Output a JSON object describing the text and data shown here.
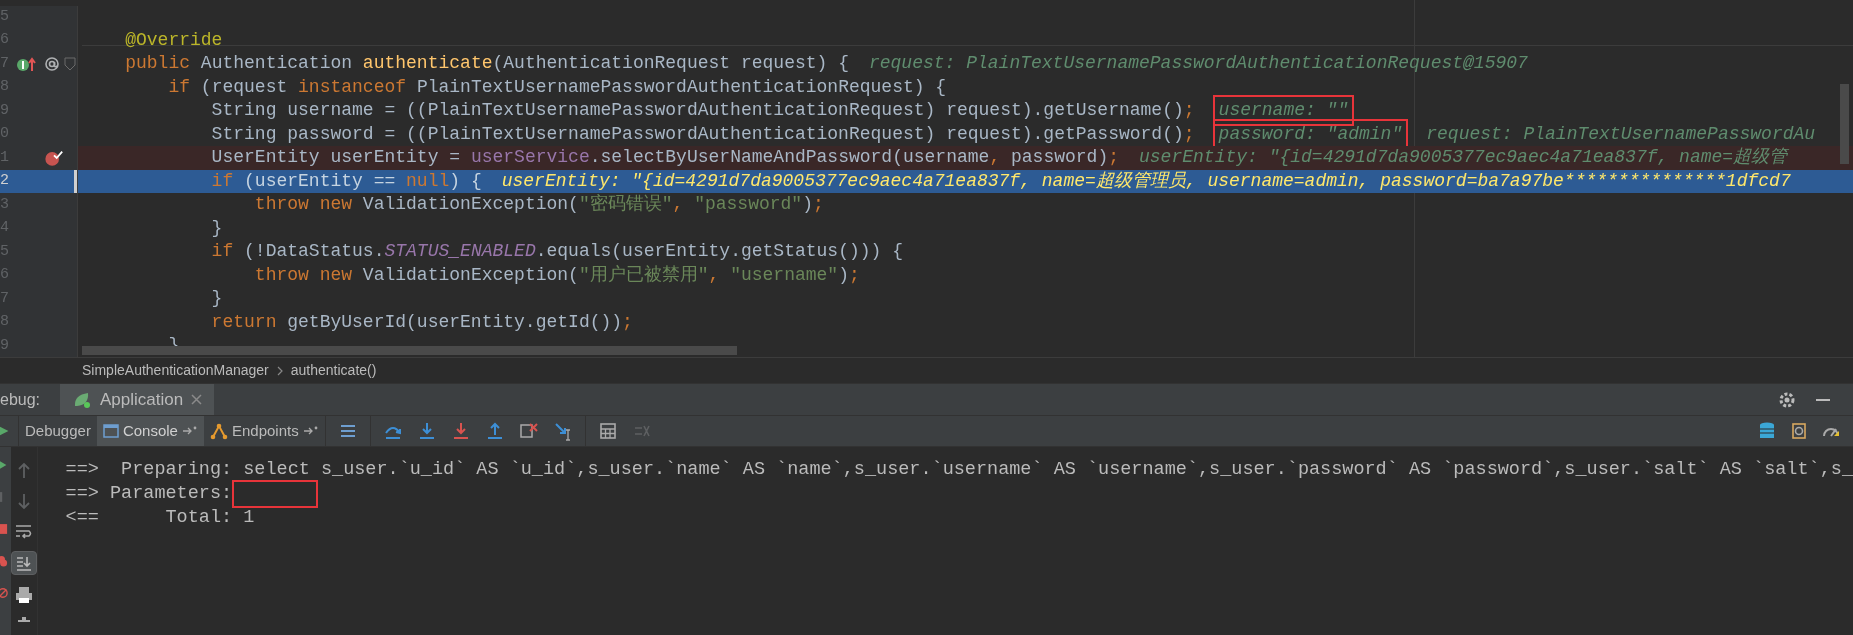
{
  "editor": {
    "lines": [
      {
        "number": "5",
        "implements": false,
        "foldable": false,
        "breakpoint": false,
        "current": false
      },
      {
        "number": "6",
        "implements": false,
        "foldable": false,
        "breakpoint": false,
        "current": false,
        "tokens": [
          {
            "kind": "annotation",
            "text": "    @Override"
          }
        ]
      },
      {
        "number": "7",
        "implements": true,
        "foldable": true,
        "breakpoint": false,
        "current": false,
        "tokens": [
          {
            "kind": "keyword",
            "text": "    public "
          },
          {
            "kind": "plain",
            "text": "Authentication "
          },
          {
            "kind": "method",
            "text": "authenticate"
          },
          {
            "kind": "plain",
            "text": "(AuthenticationRequest request) {"
          },
          {
            "kind": "inline",
            "text": "request: PlainTextUsernamePasswordAuthenticationRequest@15907"
          }
        ]
      },
      {
        "number": "8",
        "implements": false,
        "foldable": false,
        "breakpoint": false,
        "current": false,
        "tokens": [
          {
            "kind": "keyword",
            "text": "        if "
          },
          {
            "kind": "plain",
            "text": "(request "
          },
          {
            "kind": "keyword",
            "text": "instanceof "
          },
          {
            "kind": "plain",
            "text": "PlainTextUsernamePasswordAuthenticationRequest) {"
          }
        ]
      },
      {
        "number": "9",
        "implements": false,
        "foldable": false,
        "breakpoint": false,
        "current": false,
        "tokens": [
          {
            "kind": "plain",
            "text": "            String username = ((PlainTextUsernamePasswordAuthenticationRequest) request).getUsername()"
          },
          {
            "kind": "keyword",
            "text": ";"
          },
          {
            "kind": "inline",
            "text": "username: \"\"",
            "boxed": true
          }
        ]
      },
      {
        "number": "0",
        "implements": false,
        "foldable": false,
        "breakpoint": false,
        "current": false,
        "tokens": [
          {
            "kind": "plain",
            "text": "            String password = ((PlainTextUsernamePasswordAuthenticationRequest) request).getPassword()"
          },
          {
            "kind": "keyword",
            "text": ";"
          },
          {
            "kind": "inline",
            "text": "password: \"admin\"",
            "boxed": true
          },
          {
            "kind": "inline",
            "text": "request: PlainTextUsernamePasswordAu",
            "boxed": false
          }
        ]
      },
      {
        "number": "1",
        "implements": false,
        "foldable": false,
        "breakpoint": true,
        "current": false,
        "tokens": [
          {
            "kind": "plain",
            "text": "            UserEntity userEntity = "
          },
          {
            "kind": "field",
            "text": "userService"
          },
          {
            "kind": "plain",
            "text": ".selectByUserNameAndPassword(username"
          },
          {
            "kind": "keyword",
            "text": ", "
          },
          {
            "kind": "plain",
            "text": "password)"
          },
          {
            "kind": "keyword",
            "text": ";"
          },
          {
            "kind": "inline",
            "text": "userEntity: \"{id=4291d7da9005377ec9aec4a71ea837f, name=超级管"
          }
        ]
      },
      {
        "number": "2",
        "implements": false,
        "foldable": false,
        "breakpoint": false,
        "current": true,
        "tokens": [
          {
            "kind": "keyword",
            "text": "            if "
          },
          {
            "kind": "plain",
            "text": "(userEntity == "
          },
          {
            "kind": "keyword",
            "text": "null"
          },
          {
            "kind": "plain",
            "text": ") {"
          },
          {
            "kind": "inline",
            "text": "userEntity: \"{id=4291d7da9005377ec9aec4a71ea837f, name=超级管理员, username=admin, password=ba7a97be***************1dfcd7"
          }
        ]
      },
      {
        "number": "3",
        "implements": false,
        "foldable": false,
        "breakpoint": false,
        "current": false,
        "tokens": [
          {
            "kind": "keyword",
            "text": "                throw new "
          },
          {
            "kind": "plain",
            "text": "ValidationException("
          },
          {
            "kind": "string",
            "text": "\"密码错误\""
          },
          {
            "kind": "keyword",
            "text": ", "
          },
          {
            "kind": "string",
            "text": "\"password\""
          },
          {
            "kind": "plain",
            "text": ")"
          },
          {
            "kind": "keyword",
            "text": ";"
          }
        ]
      },
      {
        "number": "4",
        "implements": false,
        "foldable": false,
        "breakpoint": false,
        "current": false,
        "tokens": [
          {
            "kind": "plain",
            "text": "            }"
          }
        ]
      },
      {
        "number": "5",
        "implements": false,
        "foldable": false,
        "breakpoint": false,
        "current": false,
        "tokens": [
          {
            "kind": "keyword",
            "text": "            if "
          },
          {
            "kind": "plain",
            "text": "(!DataStatus."
          },
          {
            "kind": "static",
            "text": "STATUS_ENABLED"
          },
          {
            "kind": "plain",
            "text": ".equals(userEntity.getStatus())) {"
          }
        ]
      },
      {
        "number": "6",
        "implements": false,
        "foldable": false,
        "breakpoint": false,
        "current": false,
        "tokens": [
          {
            "kind": "keyword",
            "text": "                throw new "
          },
          {
            "kind": "plain",
            "text": "ValidationException("
          },
          {
            "kind": "string",
            "text": "\"用户已被禁用\""
          },
          {
            "kind": "keyword",
            "text": ", "
          },
          {
            "kind": "string",
            "text": "\"username\""
          },
          {
            "kind": "plain",
            "text": ")"
          },
          {
            "kind": "keyword",
            "text": ";"
          }
        ]
      },
      {
        "number": "7",
        "implements": false,
        "foldable": false,
        "breakpoint": false,
        "current": false,
        "tokens": [
          {
            "kind": "plain",
            "text": "            }"
          }
        ]
      },
      {
        "number": "8",
        "implements": false,
        "foldable": false,
        "breakpoint": false,
        "current": false,
        "tokens": [
          {
            "kind": "keyword",
            "text": "            return "
          },
          {
            "kind": "plain",
            "text": "getByUserId(userEntity.getId())"
          },
          {
            "kind": "keyword",
            "text": ";"
          }
        ]
      },
      {
        "number": "9",
        "implements": false,
        "foldable": false,
        "breakpoint": false,
        "current": false,
        "tokens": [
          {
            "kind": "plain",
            "text": "        }"
          }
        ]
      }
    ]
  },
  "breadcrumb": [
    "SimpleAuthenticationManager",
    "authenticate()"
  ],
  "debug_panel": {
    "label": "ebug:",
    "session_tab": {
      "label": "Application",
      "selected": true
    },
    "tabs": [
      {
        "label": "Debugger",
        "selected": false,
        "kind": "plain"
      },
      {
        "label": "Console",
        "selected": true,
        "kind": "console"
      },
      {
        "label": "Endpoints",
        "selected": false,
        "kind": "endpoints"
      }
    ],
    "console_lines": [
      {
        "text": "==>  Preparing: select s_user.`u_id` AS `u_id`,s_user.`name` AS `name`,s_user.`username` AS `username`,s_user.`password` AS `password`,s_user.`salt` AS `salt`,s_",
        "blank_box": false
      },
      {
        "text": "==> Parameters:",
        "blank_box": true
      },
      {
        "text": "<==      Total: 1",
        "blank_box": false
      }
    ]
  }
}
